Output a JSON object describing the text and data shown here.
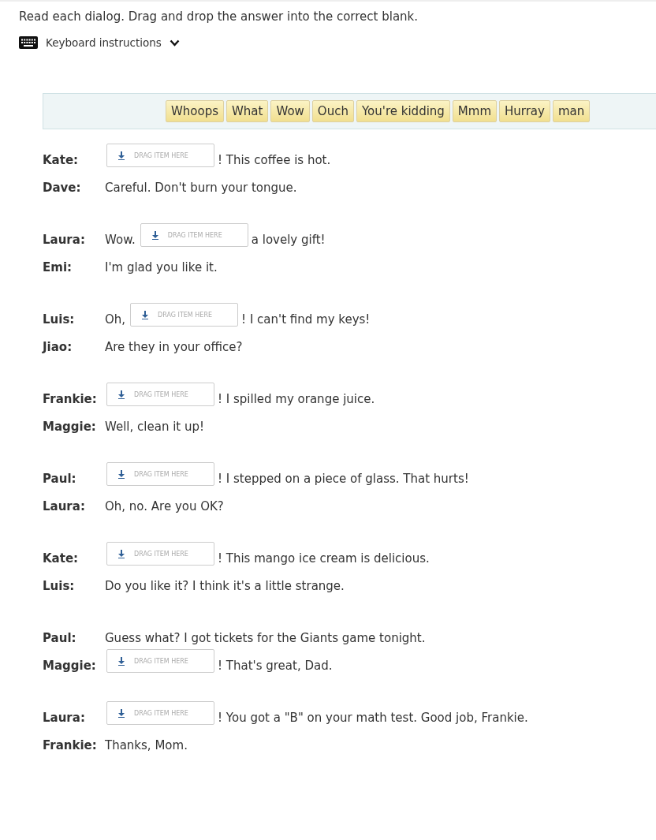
{
  "instructions": "Read each dialog. Drag and drop the answer into the correct blank.",
  "keyboard_toggle": {
    "label": "Keyboard instructions",
    "expanded": false
  },
  "word_bank": [
    "Whoops",
    "What",
    "Wow",
    "Ouch",
    "You're kidding",
    "Mmm",
    "Hurray",
    "man"
  ],
  "dialogs": [
    {
      "lines": [
        {
          "speaker": "Kate:",
          "segments": [
            {
              "kind": "blank",
              "placeholder": "DRAG ITEM HERE"
            },
            {
              "kind": "text",
              "text": "! This coffee is hot."
            }
          ]
        },
        {
          "speaker": "Dave:",
          "segments": [
            {
              "kind": "text",
              "text": "Careful. Don't burn your tongue."
            }
          ]
        }
      ]
    },
    {
      "lines": [
        {
          "speaker": "Laura:",
          "segments": [
            {
              "kind": "text",
              "text": "Wow."
            },
            {
              "kind": "blank",
              "placeholder": "DRAG ITEM HERE"
            },
            {
              "kind": "text",
              "text": "a lovely gift!"
            }
          ]
        },
        {
          "speaker": "Emi:",
          "segments": [
            {
              "kind": "text",
              "text": "I'm glad you like it."
            }
          ]
        }
      ]
    },
    {
      "lines": [
        {
          "speaker": "Luis:",
          "segments": [
            {
              "kind": "text",
              "text": "Oh,"
            },
            {
              "kind": "blank",
              "placeholder": "DRAG ITEM HERE"
            },
            {
              "kind": "text",
              "text": "! I can't find my keys!"
            }
          ]
        },
        {
          "speaker": "Jiao:",
          "segments": [
            {
              "kind": "text",
              "text": "Are they in your office?"
            }
          ]
        }
      ]
    },
    {
      "lines": [
        {
          "speaker": "Frankie:",
          "segments": [
            {
              "kind": "blank",
              "placeholder": "DRAG ITEM HERE"
            },
            {
              "kind": "text",
              "text": "! I spilled my orange juice."
            }
          ]
        },
        {
          "speaker": "Maggie:",
          "segments": [
            {
              "kind": "text",
              "text": "Well, clean it up!"
            }
          ]
        }
      ]
    },
    {
      "lines": [
        {
          "speaker": "Paul:",
          "segments": [
            {
              "kind": "blank",
              "placeholder": "DRAG ITEM HERE"
            },
            {
              "kind": "text",
              "text": "! I stepped on a piece of glass. That hurts!"
            }
          ]
        },
        {
          "speaker": "Laura:",
          "segments": [
            {
              "kind": "text",
              "text": "Oh, no. Are you OK?"
            }
          ]
        }
      ]
    },
    {
      "lines": [
        {
          "speaker": "Kate:",
          "segments": [
            {
              "kind": "blank",
              "placeholder": "DRAG ITEM HERE"
            },
            {
              "kind": "text",
              "text": "! This mango ice cream is delicious."
            }
          ]
        },
        {
          "speaker": "Luis:",
          "segments": [
            {
              "kind": "text",
              "text": "Do you like it? I think it's a little strange."
            }
          ]
        }
      ]
    },
    {
      "lines": [
        {
          "speaker": "Paul:",
          "segments": [
            {
              "kind": "text",
              "text": "Guess what? I got tickets for the Giants game tonight."
            }
          ]
        },
        {
          "speaker": "Maggie:",
          "segments": [
            {
              "kind": "blank",
              "placeholder": "DRAG ITEM HERE"
            },
            {
              "kind": "text",
              "text": "! That's great, Dad."
            }
          ]
        }
      ]
    },
    {
      "lines": [
        {
          "speaker": "Laura:",
          "segments": [
            {
              "kind": "blank",
              "placeholder": "DRAG ITEM HERE"
            },
            {
              "kind": "text",
              "text": "! You got a \"B\" on your math test. Good job, Frankie."
            }
          ]
        },
        {
          "speaker": "Frankie:",
          "segments": [
            {
              "kind": "text",
              "text": "Thanks, Mom."
            }
          ]
        }
      ]
    }
  ]
}
